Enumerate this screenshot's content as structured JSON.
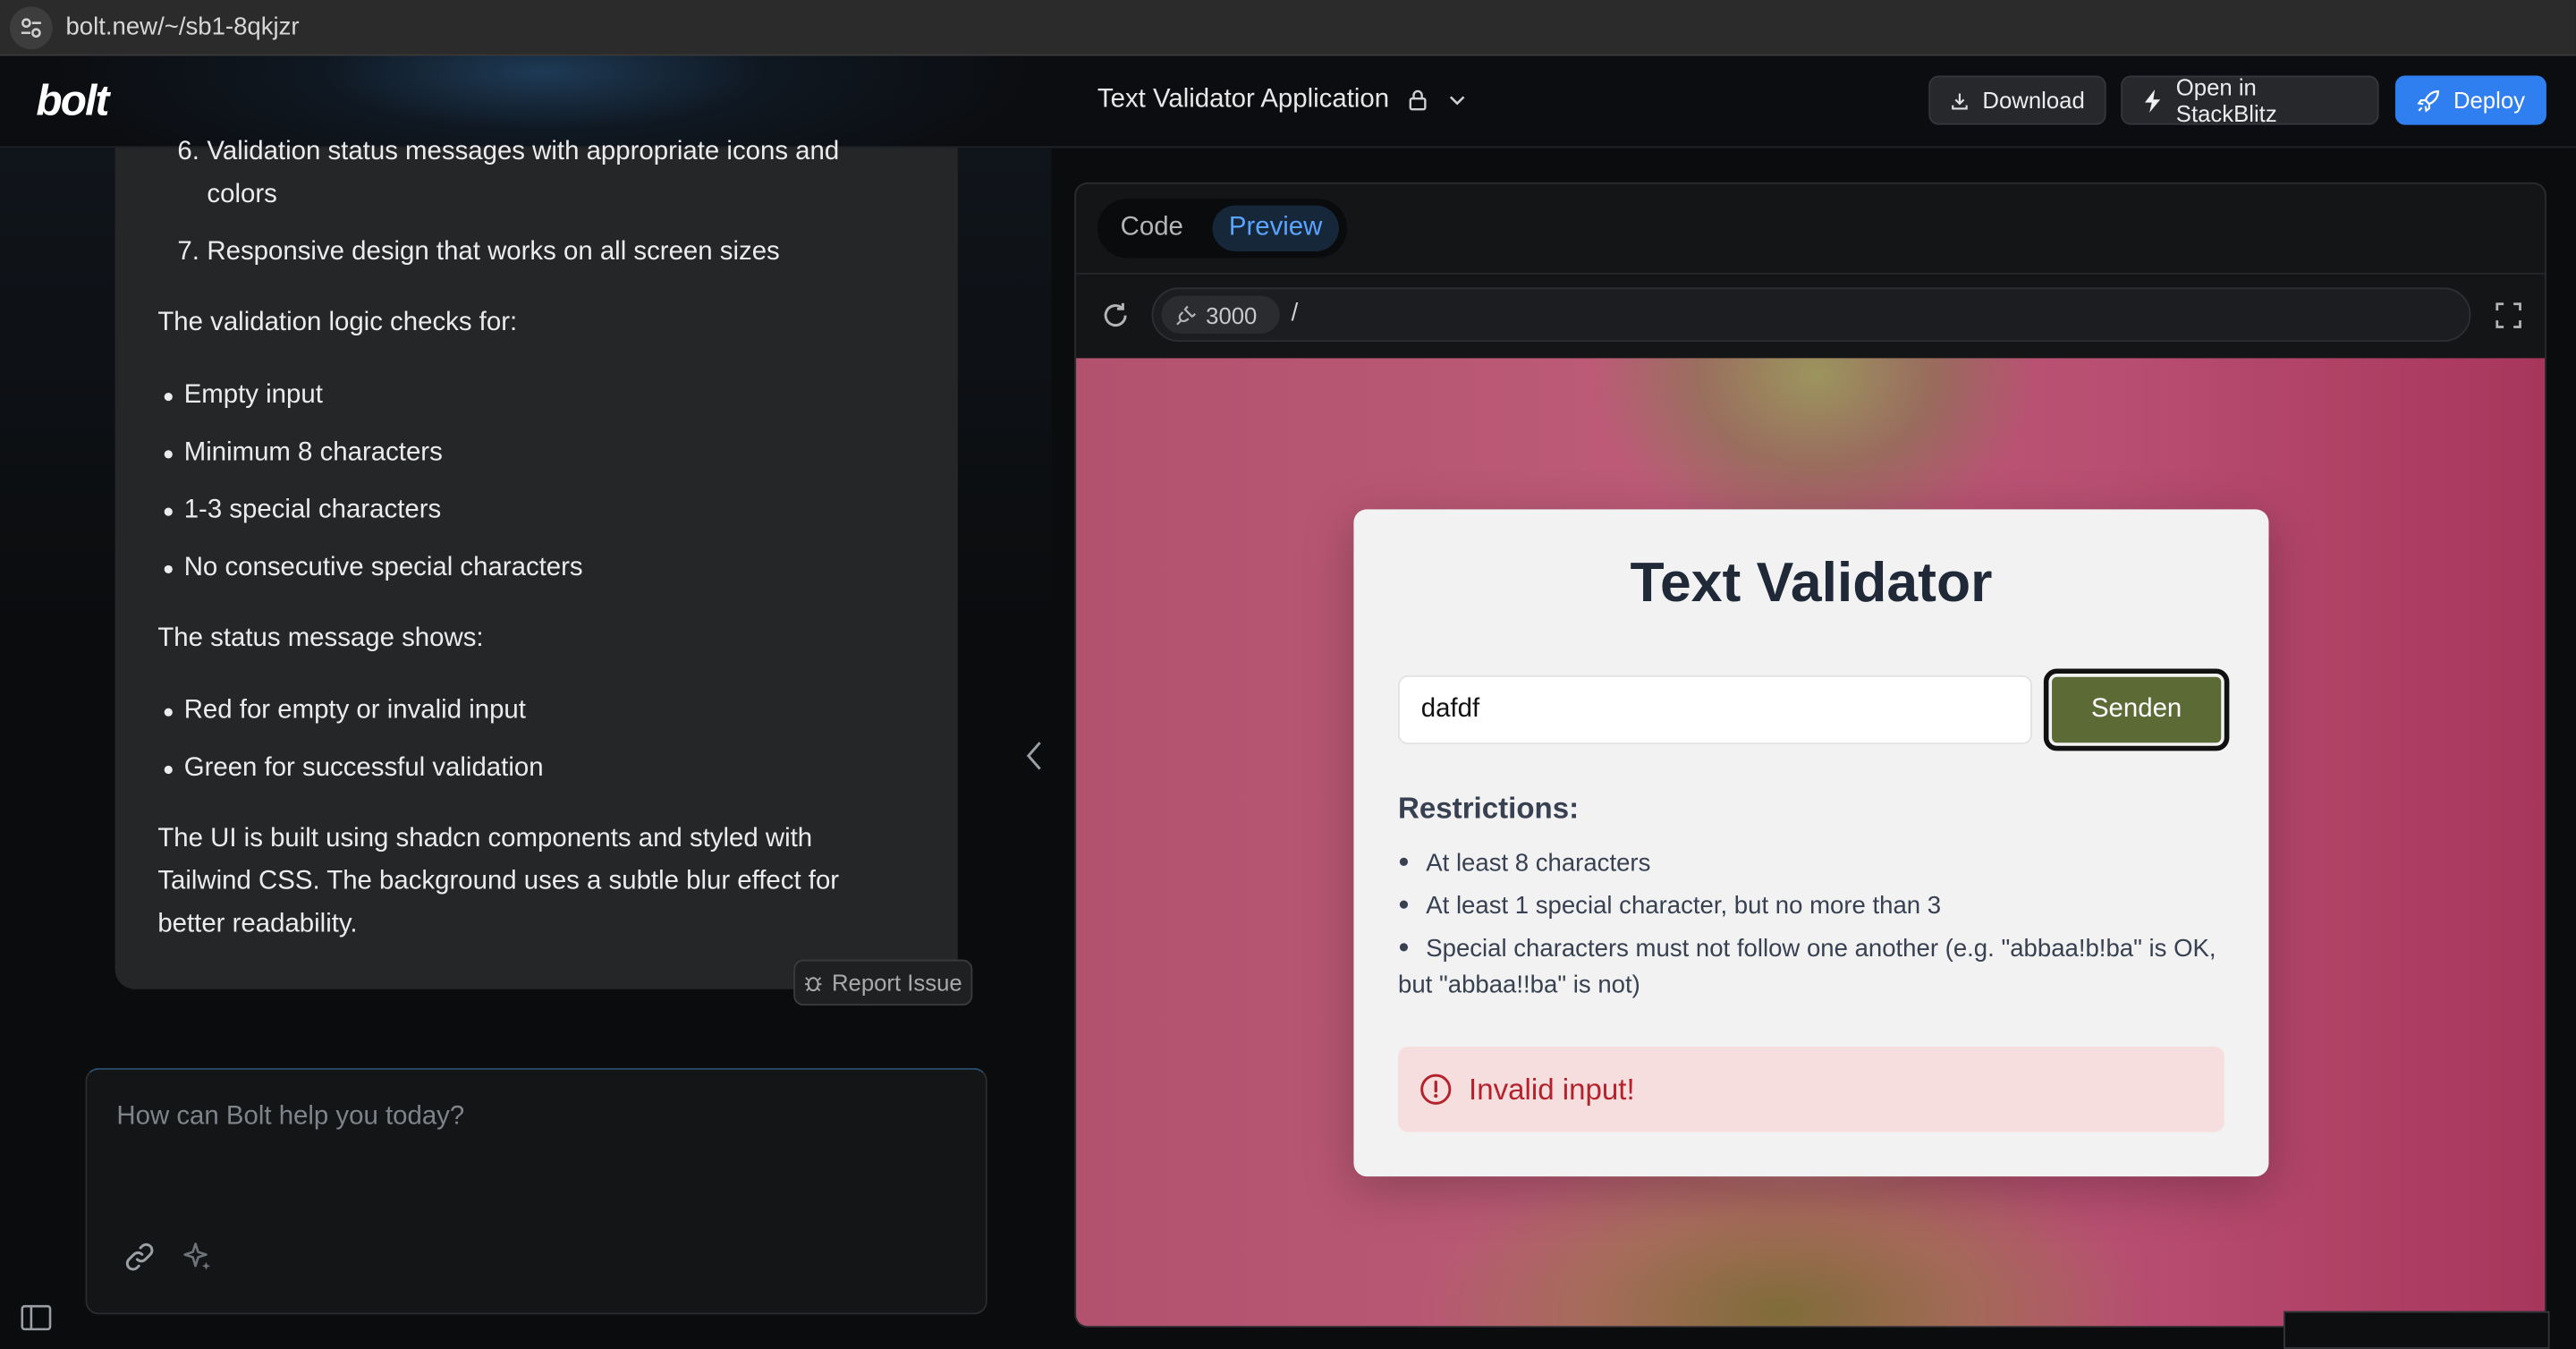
{
  "browser": {
    "url": "bolt.new/~/sb1-8qkjzr"
  },
  "header": {
    "logo": "bolt",
    "project_title": "Text Validator Application",
    "download_label": "Download",
    "stackblitz_label": "Open in StackBlitz",
    "deploy_label": "Deploy"
  },
  "chat": {
    "list_items": [
      {
        "num": "6.",
        "text": "Validation status messages with appropriate icons and colors"
      },
      {
        "num": "7.",
        "text": "Responsive design that works on all screen sizes"
      }
    ],
    "validation_intro": "The validation logic checks for:",
    "validation_checks": [
      "Empty input",
      "Minimum 8 characters",
      "1-3 special characters",
      "No consecutive special characters"
    ],
    "status_intro": "The status message shows:",
    "status_items": [
      "Red for empty or invalid input",
      "Green for successful validation"
    ],
    "closing": "The UI is built using shadcn components and styled with Tailwind CSS. The background uses a subtle blur effect for better readability.",
    "report_issue_label": "Report Issue",
    "prompt_placeholder": "How can Bolt help you today?"
  },
  "workbench": {
    "tabs": [
      "Code",
      "Preview"
    ],
    "active_tab": "Preview",
    "port": "3000",
    "path": "/"
  },
  "app_preview": {
    "title": "Text Validator",
    "input_value": "dafdf",
    "send_label": "Senden",
    "restrictions_title": "Restrictions:",
    "restrictions": [
      "At least 8 characters",
      "At least 1 special character, but no more than 3",
      "Special characters must not follow one another (e.g. \"abbaa!b!ba\" is OK, but \"abbaa!!ba\" is not)"
    ],
    "alert_text": "Invalid input!",
    "alert_color": "#b4232c"
  },
  "colors": {
    "accent": "#2f7ff0",
    "preview_tab": "#5aa4ff",
    "send_button": "#5c6b35"
  }
}
